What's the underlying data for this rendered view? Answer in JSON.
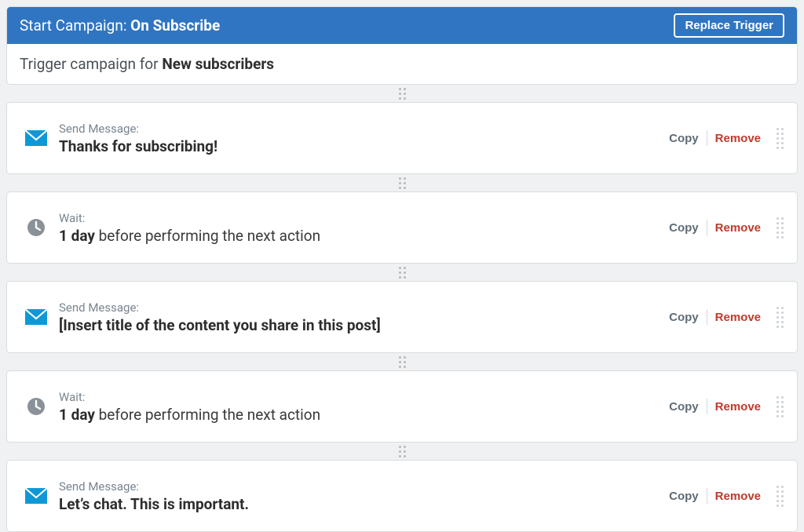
{
  "header": {
    "title_prefix": "Start Campaign: ",
    "title_emph": "On Subscribe",
    "replace_label": "Replace Trigger",
    "sub_prefix": "Trigger campaign for ",
    "sub_emph": "New subscribers"
  },
  "actions": {
    "copy": "Copy",
    "remove": "Remove"
  },
  "steps": [
    {
      "type": "message",
      "label": "Send Message:",
      "emph": "Thanks for subscribing!",
      "rest": ""
    },
    {
      "type": "wait",
      "label": "Wait:",
      "emph": "1 day",
      "rest": " before performing the next action"
    },
    {
      "type": "message",
      "label": "Send Message:",
      "emph": "[Insert title of the content you share in this post]",
      "rest": ""
    },
    {
      "type": "wait",
      "label": "Wait:",
      "emph": "1 day",
      "rest": " before performing the next action"
    },
    {
      "type": "message",
      "label": "Send Message:",
      "emph": "Let’s chat. This is important.",
      "rest": ""
    }
  ]
}
